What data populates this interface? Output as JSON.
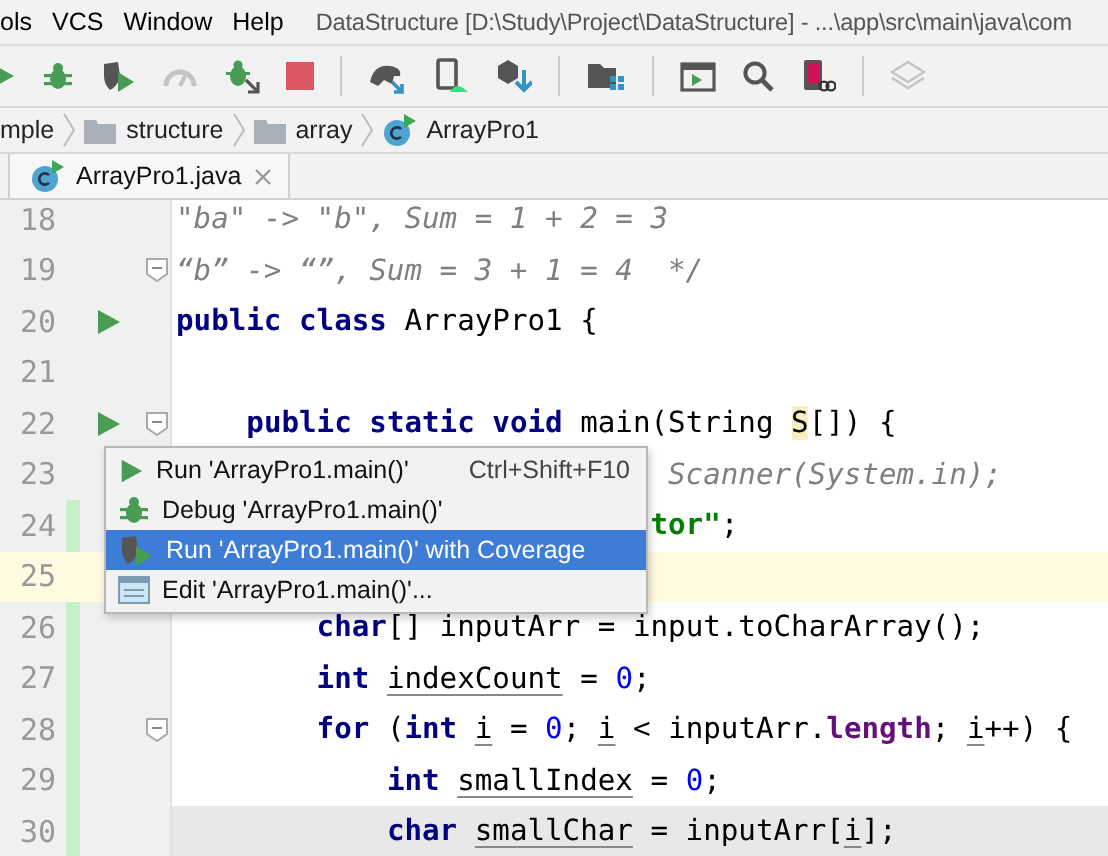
{
  "menu": [
    {
      "label": "ols"
    },
    {
      "label": "VCS"
    },
    {
      "label": "Window"
    },
    {
      "label": "Help"
    }
  ],
  "window": {
    "title": "DataStructure [D:\\Study\\Project\\DataStructure] - ...\\app\\src\\main\\java\\com"
  },
  "breadcrumbs": [
    {
      "label": "mple",
      "kind": "text"
    },
    {
      "label": "structure",
      "kind": "folder"
    },
    {
      "label": "array",
      "kind": "folder"
    },
    {
      "label": "ArrayPro1",
      "kind": "class"
    }
  ],
  "tabs": [
    {
      "label": "ArrayPro1.java",
      "selected": true
    }
  ],
  "editor": {
    "lines": [
      {
        "number": "18",
        "tokens": [
          {
            "text": "\"ba\" -> \"b\", Sum = 1 + 2 = 3",
            "kind": "comment"
          }
        ]
      },
      {
        "number": "19",
        "fold": true,
        "tokens": [
          {
            "text": "“b” -> “”, Sum = 3 + 1 = 4  */",
            "kind": "comment"
          }
        ]
      },
      {
        "number": "20",
        "run_marker": true,
        "tokens": [
          {
            "text": "public class",
            "kind": "keyword"
          },
          {
            "text": " ArrayPro1 {",
            "kind": "plain"
          }
        ]
      },
      {
        "number": "21"
      },
      {
        "number": "22",
        "run_marker": true,
        "fold": true,
        "tokens": [
          {
            "text": "    public static void",
            "kind": "keyword"
          },
          {
            "text": " main(String ",
            "kind": "plain"
          },
          {
            "text": "S",
            "kind": "match"
          },
          {
            "text": "[]) {",
            "kind": "plain"
          }
        ]
      },
      {
        "number": "23",
        "tokens": [
          {
            "text": "                            Scanner(System.in);",
            "kind": "comment"
          }
        ]
      },
      {
        "number": "24",
        "changed": true,
        "tokens": [
          {
            "text": "                           tor\"",
            "kind": "string"
          },
          {
            "text": ";",
            "kind": "plain"
          }
        ]
      },
      {
        "number": "25",
        "current": true
      },
      {
        "number": "26",
        "changed": true,
        "tokens": [
          {
            "text": "        char",
            "kind": "keyword"
          },
          {
            "text": "[] inputArr = input.toCharArray();",
            "kind": "plain"
          }
        ]
      },
      {
        "number": "27",
        "changed": true,
        "tokens": [
          {
            "text": "        int ",
            "kind": "keyword"
          },
          {
            "text": "indexCount",
            "kind": "variable"
          },
          {
            "text": " = ",
            "kind": "plain"
          },
          {
            "text": "0",
            "kind": "number"
          },
          {
            "text": ";",
            "kind": "plain"
          }
        ]
      },
      {
        "number": "28",
        "changed": true,
        "fold": true,
        "tokens": [
          {
            "text": "        for",
            "kind": "keyword"
          },
          {
            "text": " (",
            "kind": "plain"
          },
          {
            "text": "int ",
            "kind": "keyword"
          },
          {
            "text": "i",
            "kind": "variable"
          },
          {
            "text": " = ",
            "kind": "plain"
          },
          {
            "text": "0",
            "kind": "number"
          },
          {
            "text": "; ",
            "kind": "plain"
          },
          {
            "text": "i",
            "kind": "variable"
          },
          {
            "text": " < inputArr.",
            "kind": "plain"
          },
          {
            "text": "length",
            "kind": "field"
          },
          {
            "text": "; ",
            "kind": "plain"
          },
          {
            "text": "i",
            "kind": "variable"
          },
          {
            "text": "++) {",
            "kind": "plain"
          }
        ]
      },
      {
        "number": "29",
        "changed": true,
        "tokens": [
          {
            "text": "            int ",
            "kind": "keyword"
          },
          {
            "text": "smallIndex",
            "kind": "variable"
          },
          {
            "text": " = ",
            "kind": "plain"
          },
          {
            "text": "0",
            "kind": "number"
          },
          {
            "text": ";",
            "kind": "plain"
          }
        ]
      },
      {
        "number": "30",
        "changed": true,
        "shaded": true,
        "tokens": [
          {
            "text": "            char ",
            "kind": "keyword"
          },
          {
            "text": "smallChar",
            "kind": "variable"
          },
          {
            "text": " = inputArr[",
            "kind": "plain"
          },
          {
            "text": "i",
            "kind": "variable"
          },
          {
            "text": "];",
            "kind": "plain"
          }
        ]
      }
    ]
  },
  "popup_menu": {
    "items": [
      {
        "kind": "run",
        "label": "Run 'ArrayPro1.main()'",
        "shortcut": "Ctrl+Shift+F10",
        "selected": false
      },
      {
        "kind": "debug",
        "label": "Debug 'ArrayPro1.main()'",
        "selected": false
      },
      {
        "kind": "coverage",
        "label": "Run 'ArrayPro1.main()' with Coverage",
        "selected": true
      },
      {
        "kind": "edit",
        "label": "Edit 'ArrayPro1.main()'...",
        "selected": false
      }
    ]
  }
}
